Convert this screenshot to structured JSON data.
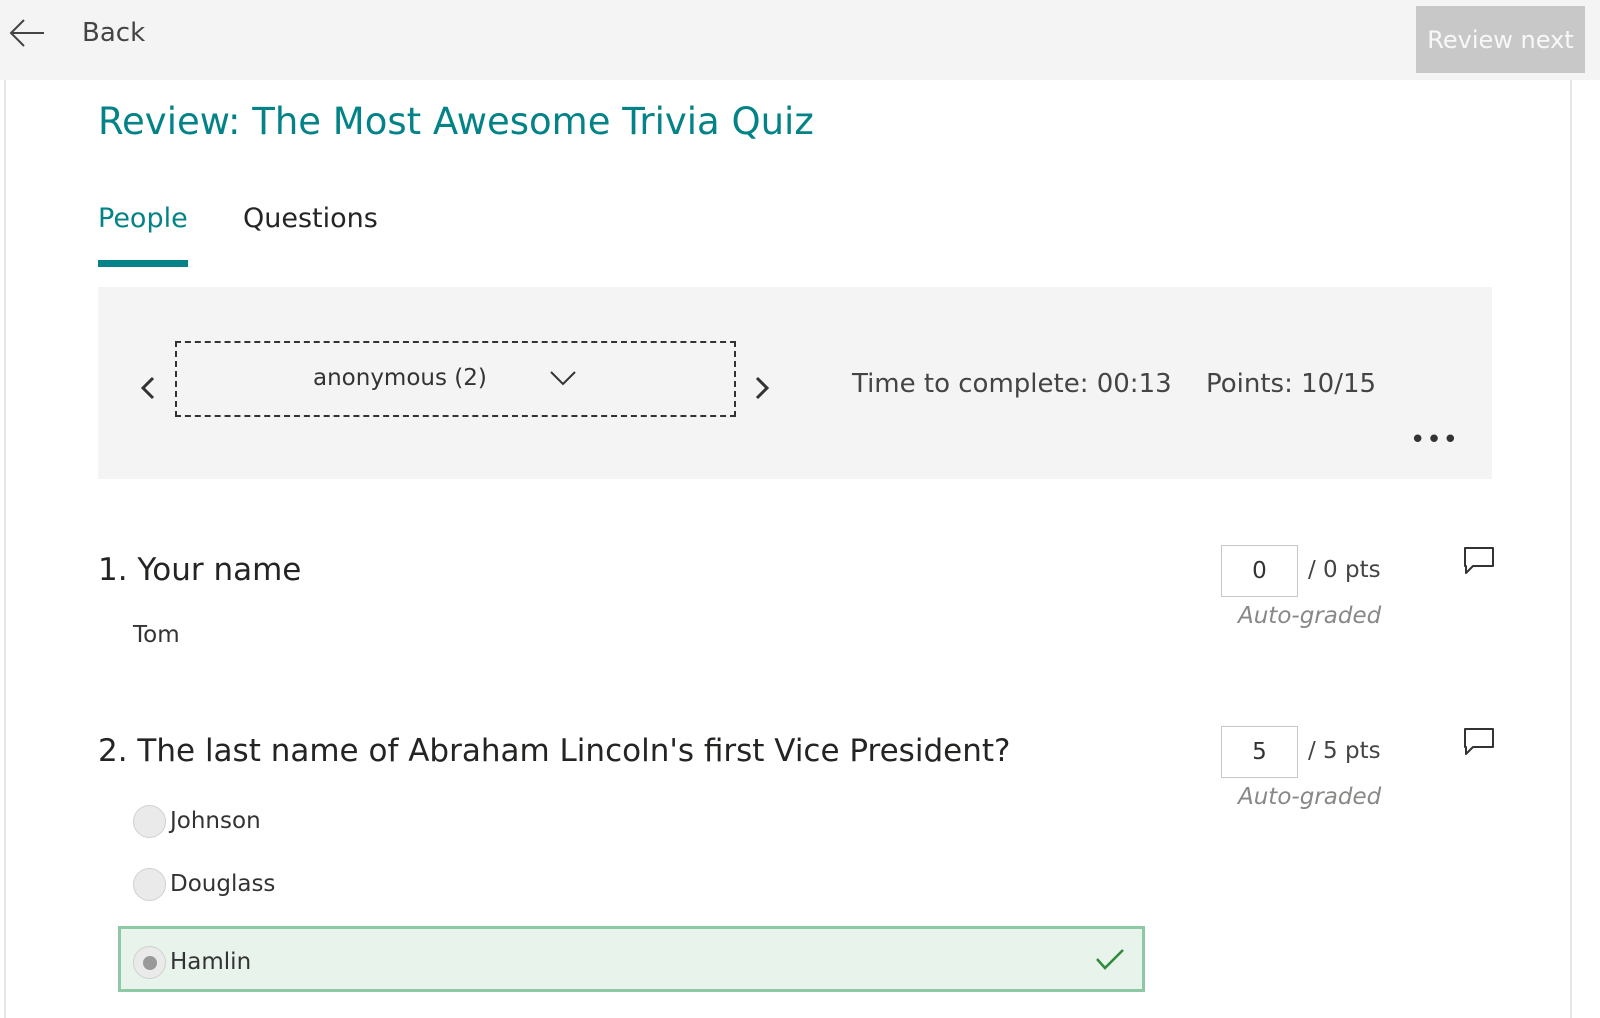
{
  "header": {
    "back_label": "Back",
    "review_next_label": "Review next"
  },
  "page": {
    "title": "Review: The Most Awesome Trivia Quiz"
  },
  "tabs": [
    {
      "label": "People",
      "active": true
    },
    {
      "label": "Questions",
      "active": false
    }
  ],
  "summary": {
    "responder": "anonymous (2)",
    "time_to_complete": "Time to complete: 00:13",
    "points": "Points: 10/15",
    "more_label": "•••"
  },
  "questions": [
    {
      "title": "1. Your name",
      "answer": "Tom",
      "score": "0",
      "max": "/ 0 pts",
      "grading": "Auto-graded"
    },
    {
      "title": "2. The last name of Abraham Lincoln's first Vice President?",
      "score": "5",
      "max": "/ 5 pts",
      "grading": "Auto-graded",
      "options": [
        {
          "label": "Johnson",
          "selected": false
        },
        {
          "label": "Douglass",
          "selected": false
        },
        {
          "label": "Hamlin",
          "selected": true,
          "correct": true
        }
      ]
    }
  ],
  "colors": {
    "accent": "#038387",
    "correct_bg": "#e8f3ec",
    "correct_border": "#8ec9a6",
    "check": "#2e8b3e"
  },
  "icons": {
    "back": "arrow-left-icon",
    "prev": "chevron-left-icon",
    "next": "chevron-right-icon",
    "dropdown": "chevron-down-icon",
    "comment": "comment-icon",
    "correct": "checkmark-icon"
  }
}
